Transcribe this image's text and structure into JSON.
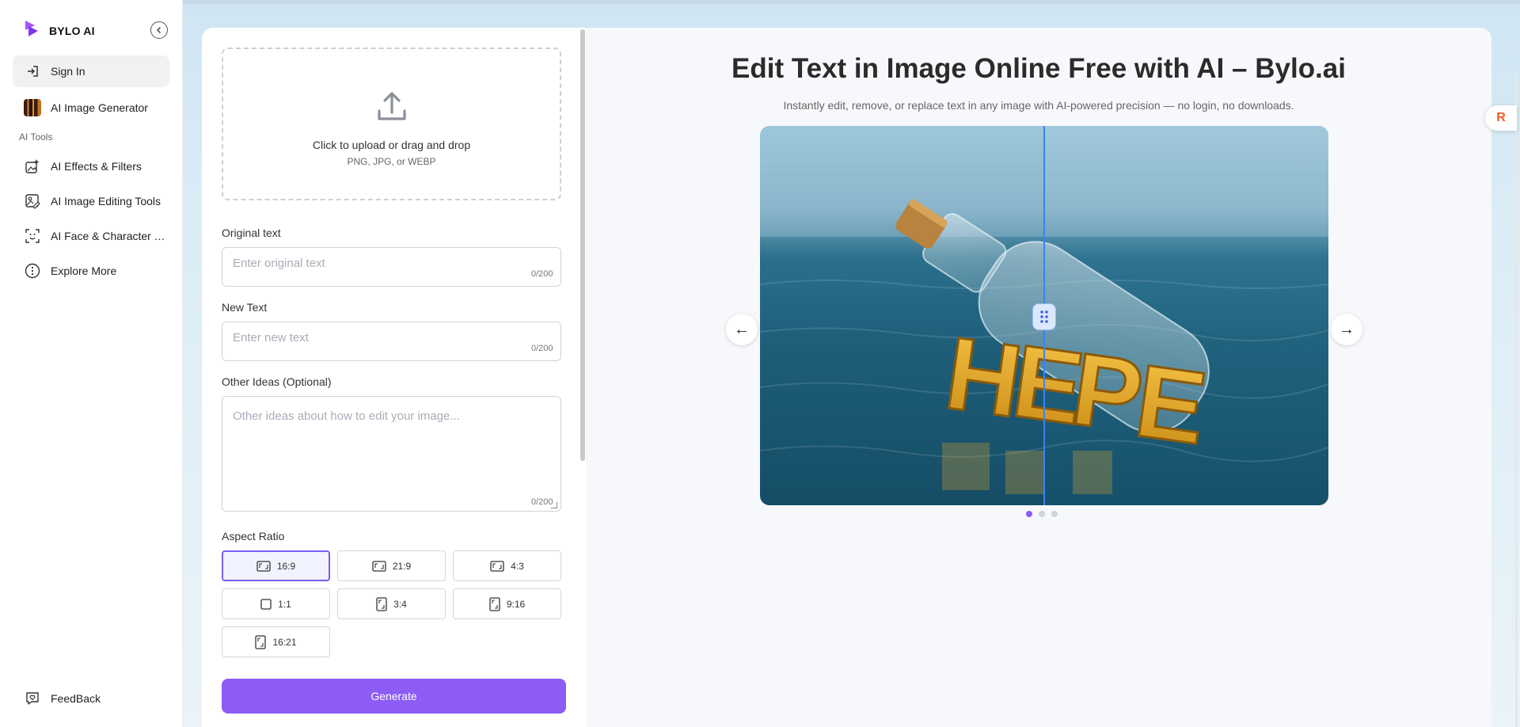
{
  "sidebar": {
    "brand": "BYLO AI",
    "sign_in": "Sign In",
    "image_generator": "AI Image Generator",
    "section_label": "AI Tools",
    "tools": [
      {
        "label": "AI Effects & Filters",
        "icon": "sparkle-image-icon"
      },
      {
        "label": "AI Image Editing Tools",
        "icon": "image-edit-icon"
      },
      {
        "label": "AI Face & Character Tools",
        "icon": "face-scan-icon"
      },
      {
        "label": "Explore More",
        "icon": "more-circle-icon"
      }
    ],
    "feedback": "FeedBack"
  },
  "form": {
    "upload_title": "Click to upload or drag and drop",
    "upload_sub": "PNG, JPG, or WEBP",
    "original_label": "Original text",
    "original_placeholder": "Enter original text",
    "original_counter": "0/200",
    "new_label": "New Text",
    "new_placeholder": "Enter new text",
    "new_counter": "0/200",
    "ideas_label": "Other Ideas (Optional)",
    "ideas_placeholder": "Other ideas about how to edit your image...",
    "ideas_counter": "0/200",
    "aspect_label": "Aspect Ratio",
    "ratios": [
      "16:9",
      "21:9",
      "4:3",
      "1:1",
      "3:4",
      "9:16",
      "16:21"
    ],
    "selected_ratio": "16:9",
    "generate": "Generate"
  },
  "preview": {
    "title": "Edit Text in Image Online Free with AI – Bylo.ai",
    "subtitle": "Instantly edit, remove, or replace text in any image with AI-powered precision — no login, no downloads.",
    "prev": "←",
    "next": "→",
    "slide_count": 3,
    "active_slide": 1
  },
  "colors": {
    "accent": "#8c5cf5",
    "divider": "#3b82f6",
    "badge": "#f15a24"
  },
  "float_badge": "R"
}
